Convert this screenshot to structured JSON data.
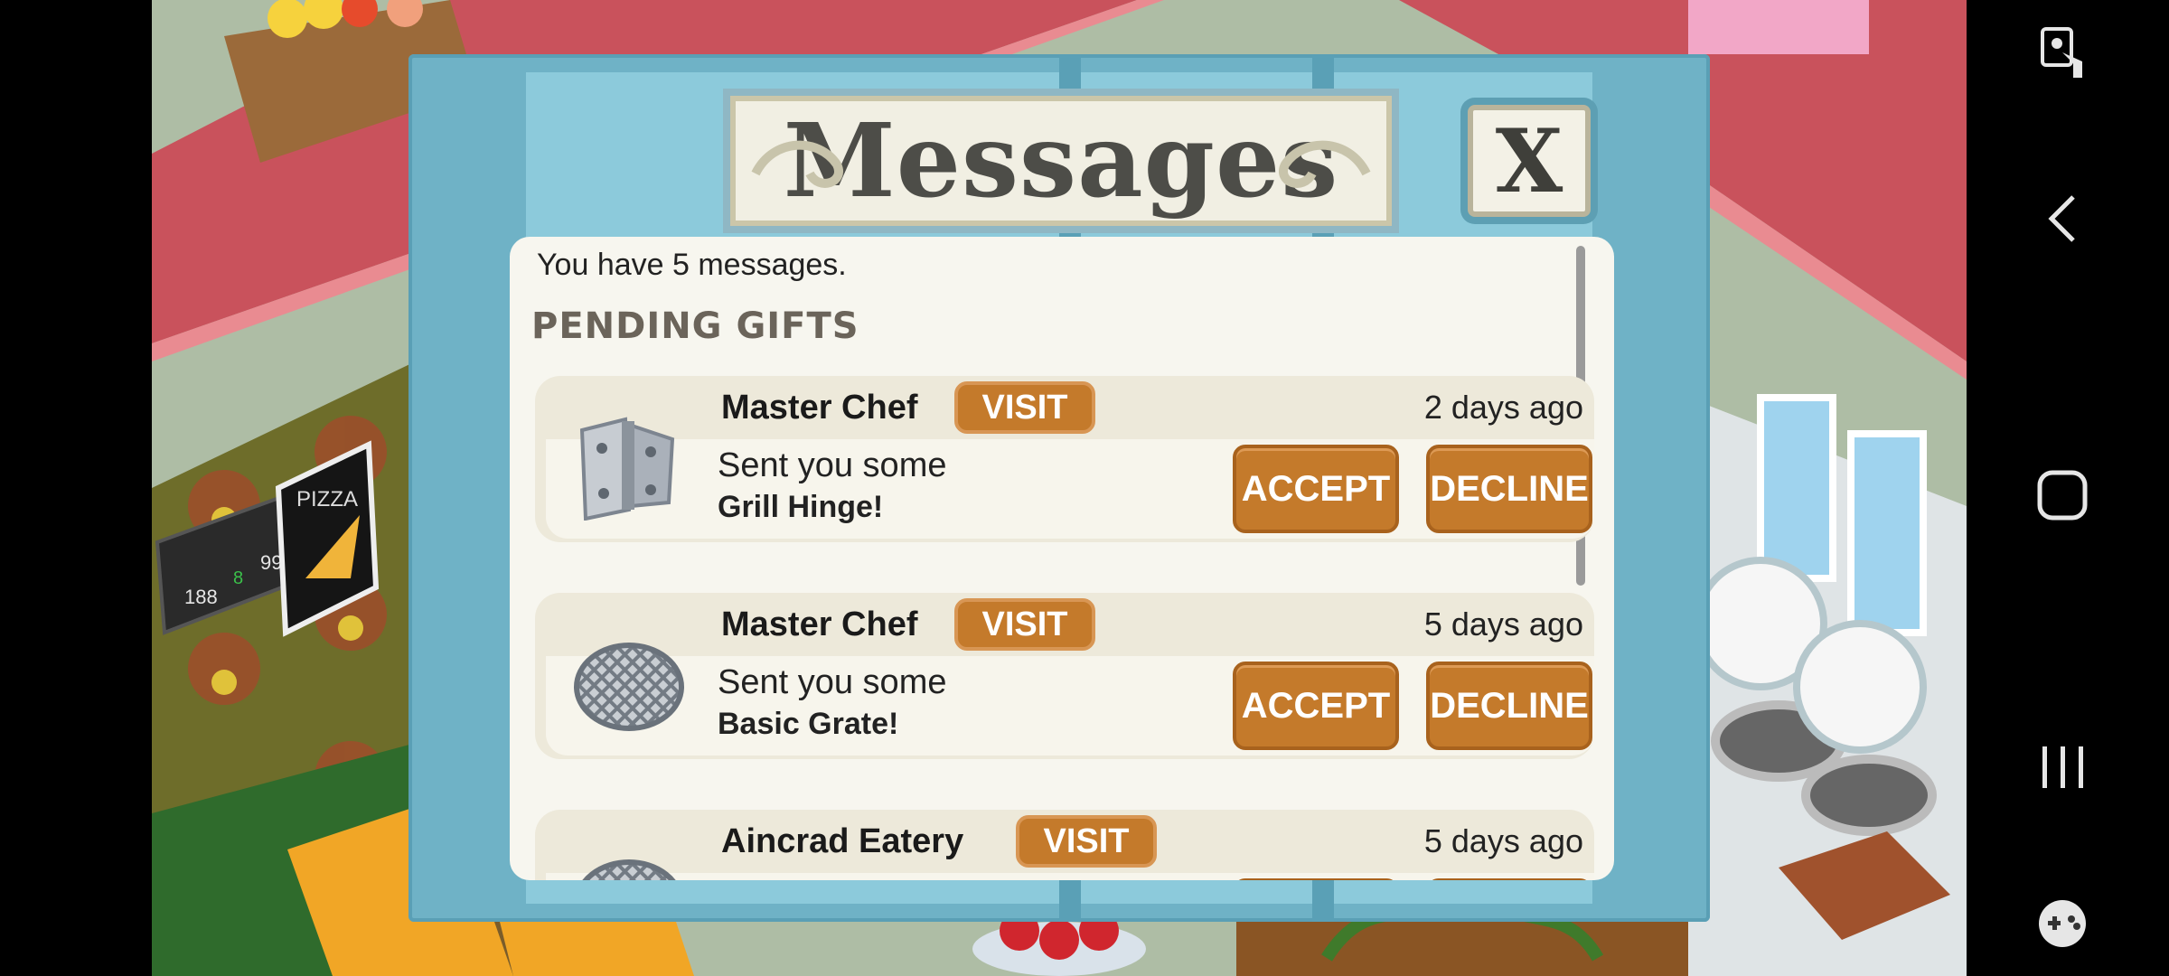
{
  "dialog": {
    "title": "Messages",
    "close_label": "X",
    "count_text": "You have 5 messages.",
    "section_title": "PENDING GIFTS"
  },
  "messages": [
    {
      "sender": "Master Chef",
      "visit_label": "VISIT",
      "time": "2 days ago",
      "line1": "Sent you some",
      "item": "Grill Hinge!",
      "accept_label": "ACCEPT",
      "decline_label": "DECLINE",
      "icon": "hinge-icon"
    },
    {
      "sender": "Master Chef",
      "visit_label": "VISIT",
      "time": "5 days ago",
      "line1": "Sent you some",
      "item": "Basic Grate!",
      "accept_label": "ACCEPT",
      "decline_label": "DECLINE",
      "icon": "grate-icon"
    },
    {
      "sender": "Aincrad Eatery",
      "visit_label": "VISIT",
      "time": "5 days ago",
      "line1": "",
      "item": "",
      "accept_label": "",
      "decline_label": "",
      "icon": "grate-icon"
    }
  ],
  "scoreboard": {
    "home": "188",
    "mid": "8",
    "guest": "99"
  },
  "poster": {
    "text": "PIZZA"
  },
  "colors": {
    "button": "#c47a2b",
    "dialog": "#6fb2c6",
    "panel": "#f7f6ef"
  }
}
